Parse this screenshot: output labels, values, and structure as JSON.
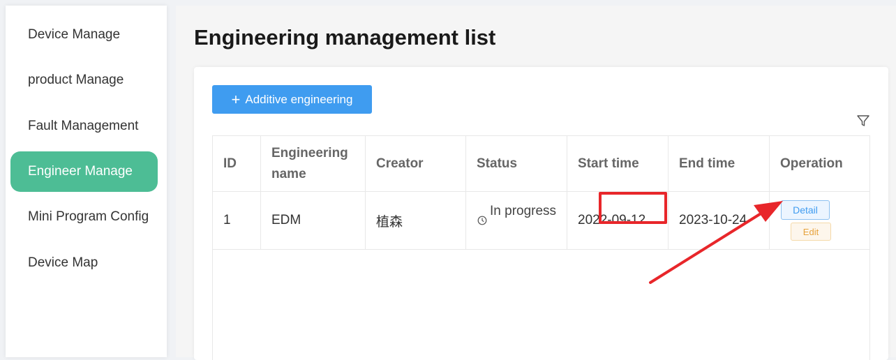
{
  "sidebar": {
    "items": [
      {
        "label": "Device Manage"
      },
      {
        "label": "product Manage"
      },
      {
        "label": "Fault Management"
      },
      {
        "label": "Engineer Manage"
      },
      {
        "label": "Mini Program Config"
      },
      {
        "label": "Device Map"
      }
    ],
    "active_item": "Engineer Manage"
  },
  "main": {
    "title": "Engineering management list",
    "add_button_label": "Additive engineering",
    "table": {
      "headers": [
        "ID",
        "Engineering name",
        "Creator",
        "Status",
        "Start time",
        "End time",
        "Operation"
      ],
      "rows": [
        {
          "id": "1",
          "name": "EDM",
          "creator": "植森",
          "status": "In progress",
          "start_time": "2022-09-12",
          "end_time": "2023-10-24",
          "detail_label": "Detail",
          "edit_label": "Edit"
        }
      ]
    }
  },
  "colors": {
    "accent": "#4dbd95",
    "primary_button": "#3f9cf0",
    "annotation_red": "#e8262a"
  },
  "icons": {
    "add": "plus-icon",
    "filter": "filter-icon",
    "status": "clock-icon"
  }
}
